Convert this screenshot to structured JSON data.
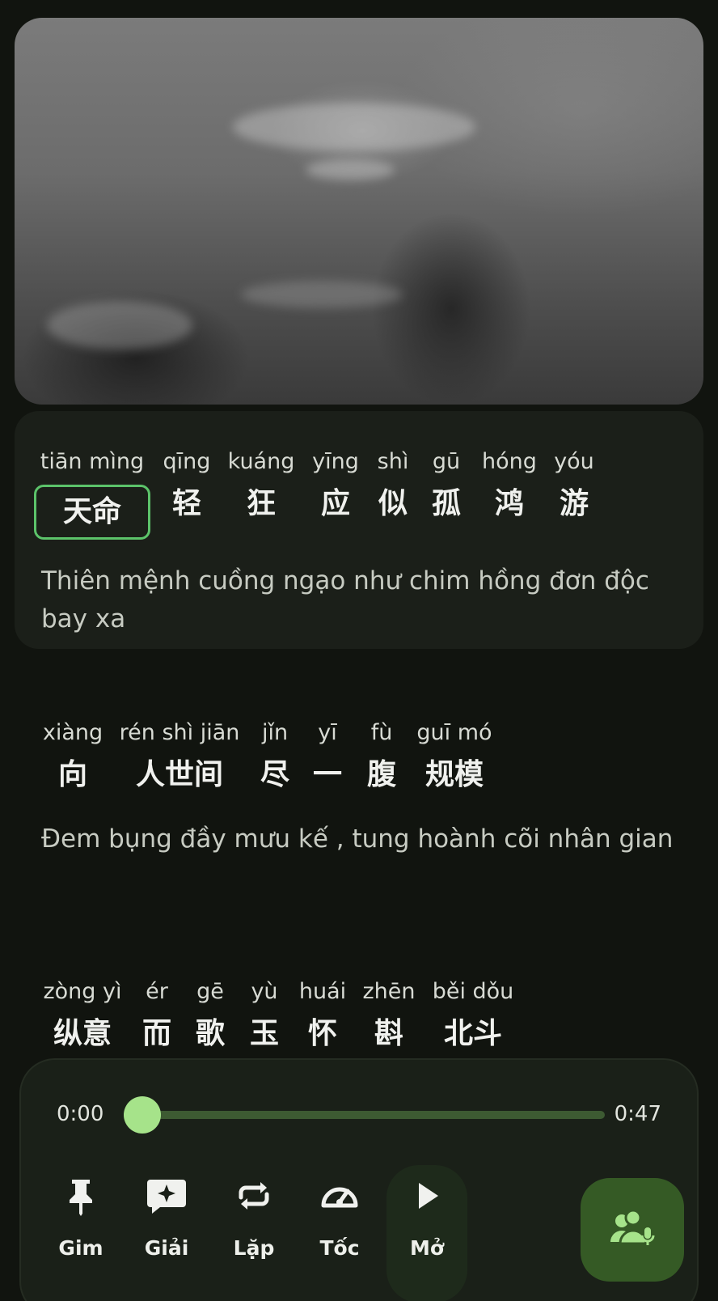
{
  "lyrics": [
    {
      "words": [
        {
          "pinyin": "tiān mìng",
          "hanzi": "天命",
          "active": true
        },
        {
          "pinyin": "qīng",
          "hanzi": "轻"
        },
        {
          "pinyin": "kuáng",
          "hanzi": "狂"
        },
        {
          "pinyin": "yīng",
          "hanzi": "应"
        },
        {
          "pinyin": "shì",
          "hanzi": "似"
        },
        {
          "pinyin": "gū",
          "hanzi": "孤"
        },
        {
          "pinyin": "hóng",
          "hanzi": "鸿"
        },
        {
          "pinyin": "yóu",
          "hanzi": "游"
        }
      ],
      "translation": "Thiên mệnh cuồng ngạo như chim hồng đơn độc bay xa"
    },
    {
      "words": [
        {
          "pinyin": "xiàng",
          "hanzi": "向"
        },
        {
          "pinyin": "rén shì jiān",
          "hanzi": "人世间"
        },
        {
          "pinyin": "jǐn",
          "hanzi": "尽"
        },
        {
          "pinyin": "yī",
          "hanzi": "一"
        },
        {
          "pinyin": "fù",
          "hanzi": "腹"
        },
        {
          "pinyin": "guī mó",
          "hanzi": "规模"
        }
      ],
      "translation": "Đem bụng đầy mưu kế , tung hoành cõi nhân gian"
    },
    {
      "words": [
        {
          "pinyin": "zòng yì",
          "hanzi": "纵意"
        },
        {
          "pinyin": "ér",
          "hanzi": "而"
        },
        {
          "pinyin": "gē",
          "hanzi": "歌"
        },
        {
          "pinyin": "yù",
          "hanzi": "玉"
        },
        {
          "pinyin": "huái",
          "hanzi": "怀"
        },
        {
          "pinyin": "zhēn",
          "hanzi": "斟"
        },
        {
          "pinyin": "běi dǒu",
          "hanzi": "北斗"
        }
      ]
    }
  ],
  "player": {
    "current_time": "0:00",
    "duration": "0:47",
    "progress": 0.0,
    "controls": [
      {
        "label": "Gim",
        "icon": "pin-icon"
      },
      {
        "label": "Giải",
        "icon": "explain-sparkle-icon"
      },
      {
        "label": "Lặp",
        "icon": "repeat-icon"
      },
      {
        "label": "Tốc",
        "icon": "speed-gauge-icon"
      },
      {
        "label": "Mở",
        "icon": "play-icon"
      }
    ],
    "mic_button_icon": "group-mic-icon"
  },
  "colors": {
    "accent": "#a6e38a",
    "active_border": "#5cc36a",
    "mic_button_bg": "#355a25"
  }
}
